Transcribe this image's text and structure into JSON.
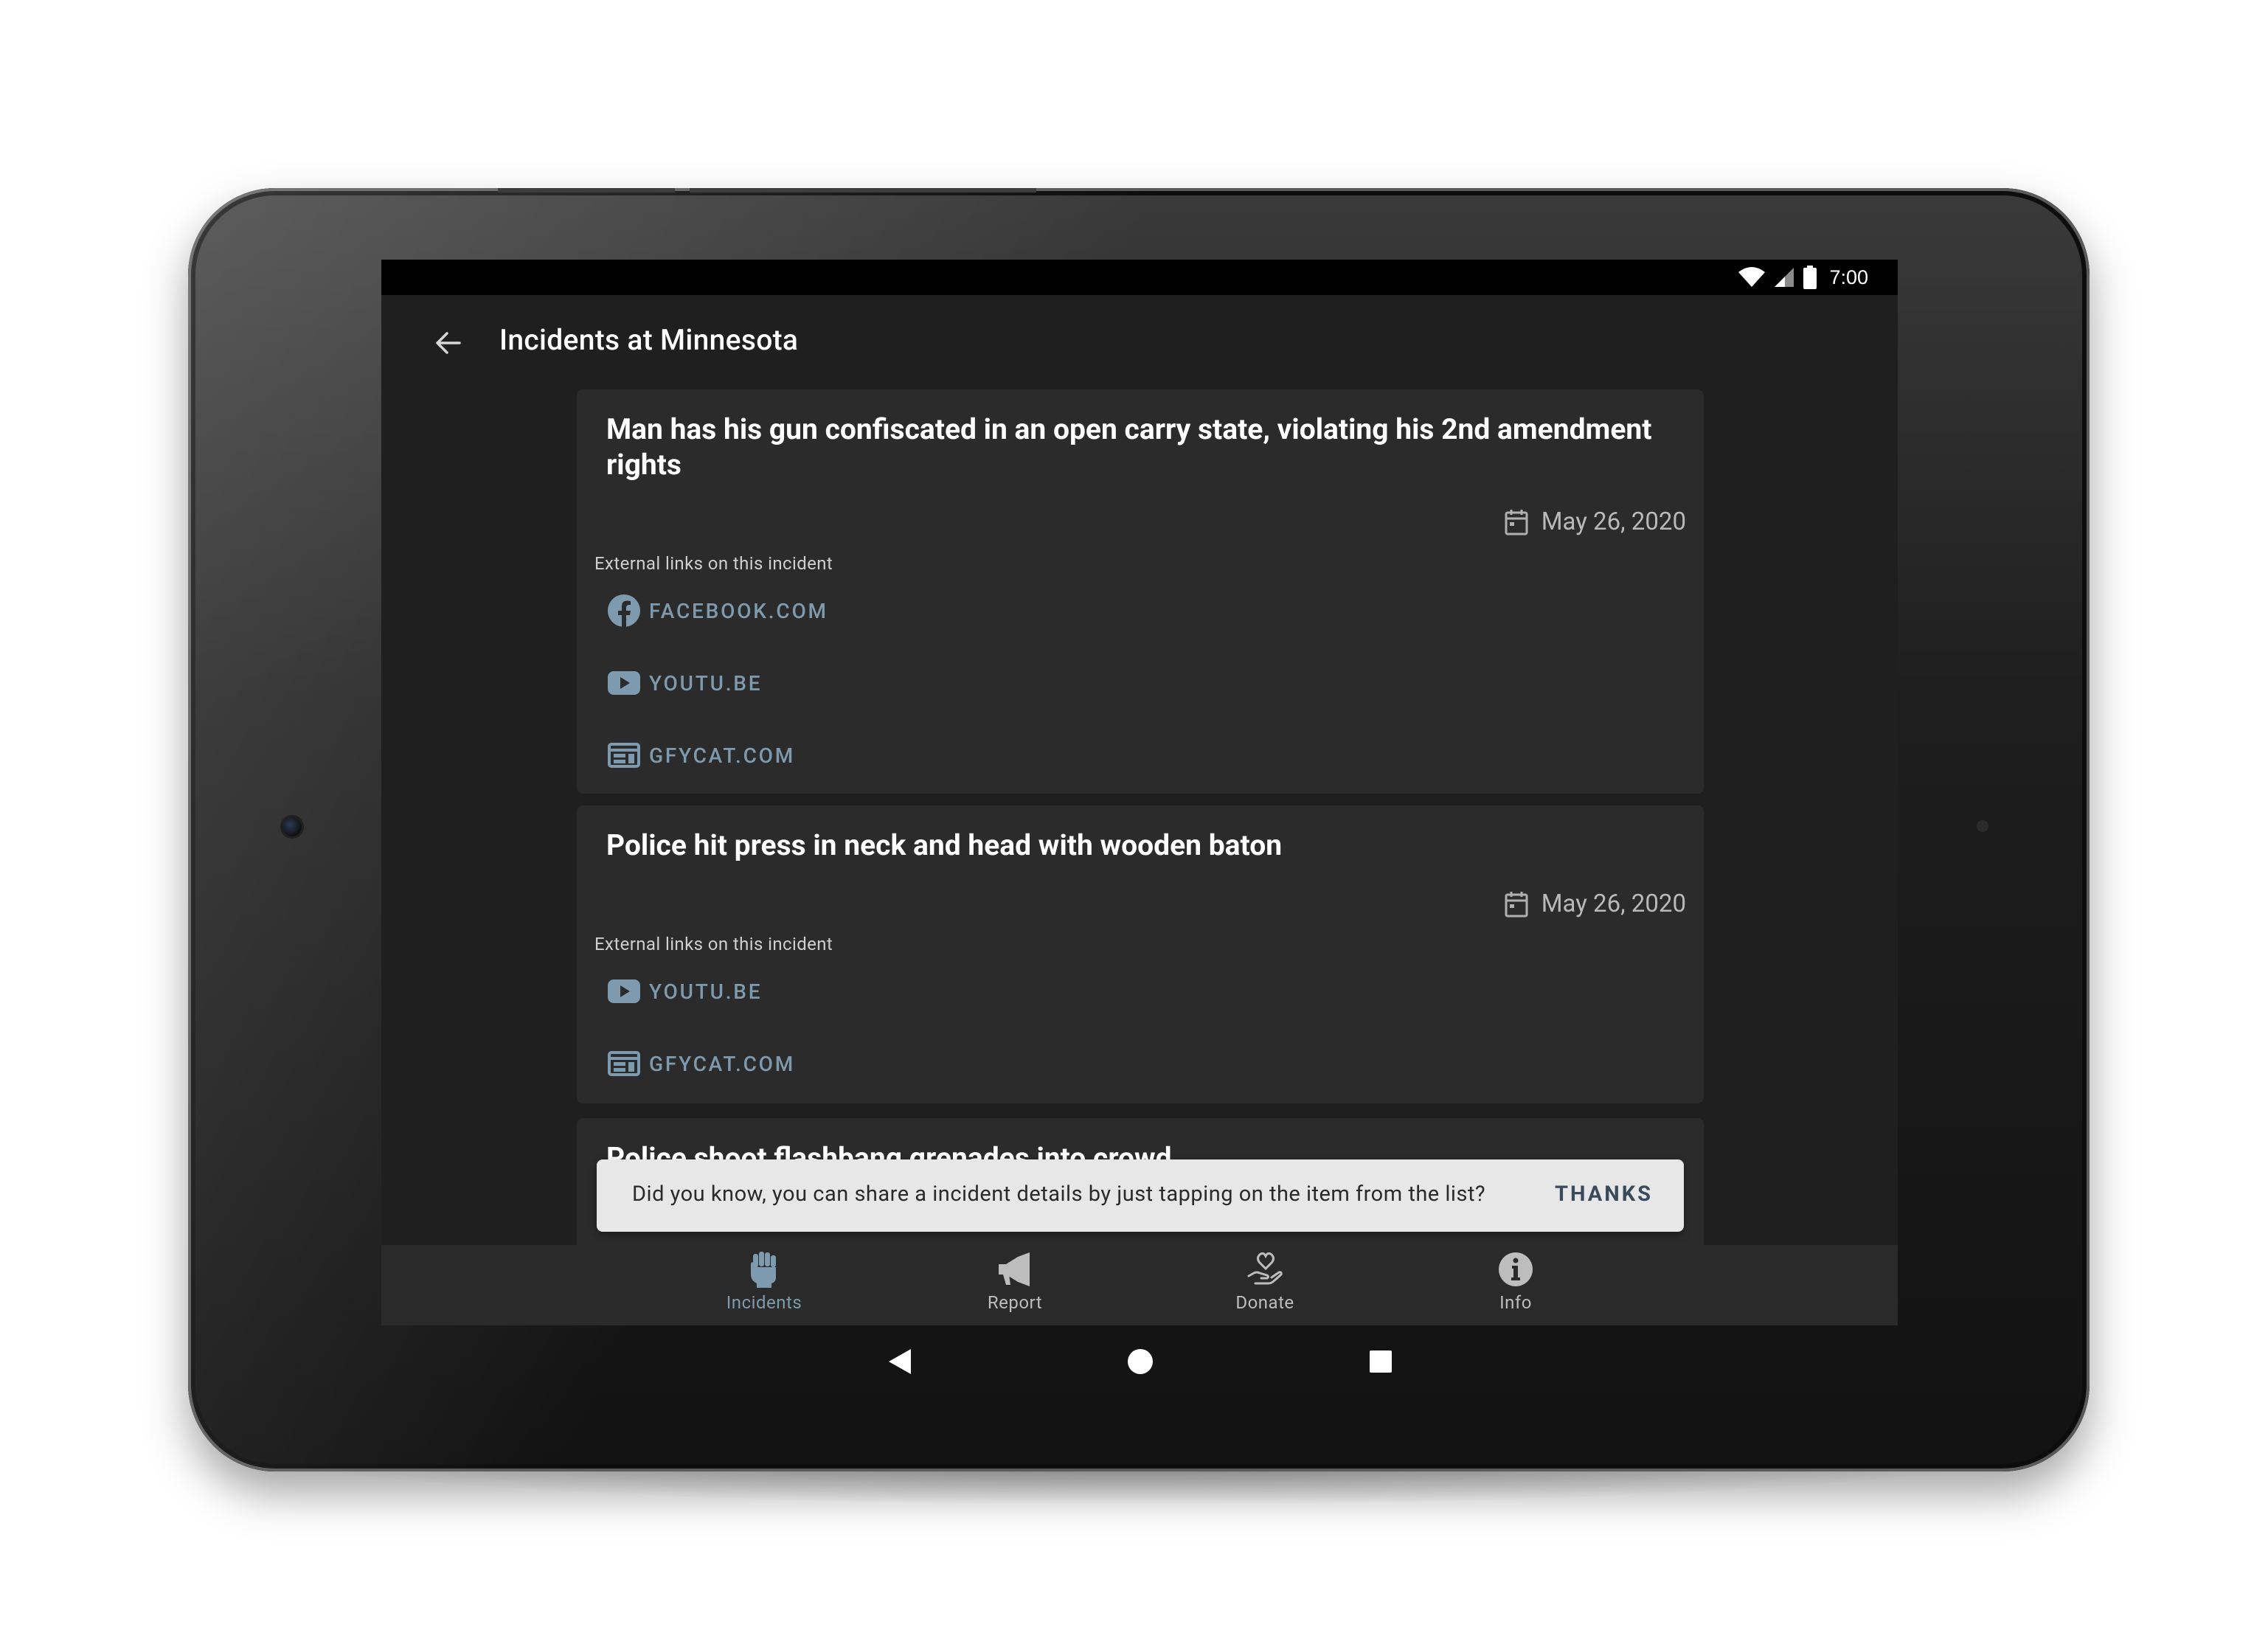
{
  "status_bar": {
    "time": "7:00"
  },
  "app_bar": {
    "title": "Incidents at Minnesota"
  },
  "incidents": [
    {
      "title": "Man has his gun confiscated in an open carry state, violating his 2nd amendment rights",
      "date": "May 26, 2020",
      "links_label": "External links on this incident",
      "links": [
        {
          "icon": "facebook-icon",
          "label": "FACEBOOK.COM"
        },
        {
          "icon": "youtube-icon",
          "label": "YOUTU.BE"
        },
        {
          "icon": "web-icon",
          "label": "GFYCAT.COM"
        }
      ]
    },
    {
      "title": "Police hit press in neck and head with wooden baton",
      "date": "May 26, 2020",
      "links_label": "External links on this incident",
      "links": [
        {
          "icon": "youtube-icon",
          "label": "YOUTU.BE"
        },
        {
          "icon": "web-icon",
          "label": "GFYCAT.COM"
        }
      ]
    },
    {
      "title": "Police shoot flashbang grenades into crowd"
    }
  ],
  "snackbar": {
    "message": "Did you know, you can share a incident details by just tapping on the item from the list?",
    "action": "THANKS"
  },
  "bottom_nav": [
    {
      "label": "Incidents",
      "icon": "raised-fist-icon",
      "active": true
    },
    {
      "label": "Report",
      "icon": "megaphone-icon",
      "active": false
    },
    {
      "label": "Donate",
      "icon": "heart-hand-icon",
      "active": false
    },
    {
      "label": "Info",
      "icon": "info-icon",
      "active": false
    }
  ],
  "colors": {
    "background": "#1f1f1f",
    "card": "#2b2b2b",
    "link": "#7e9aae",
    "snackbar": "#e7e7e7"
  }
}
